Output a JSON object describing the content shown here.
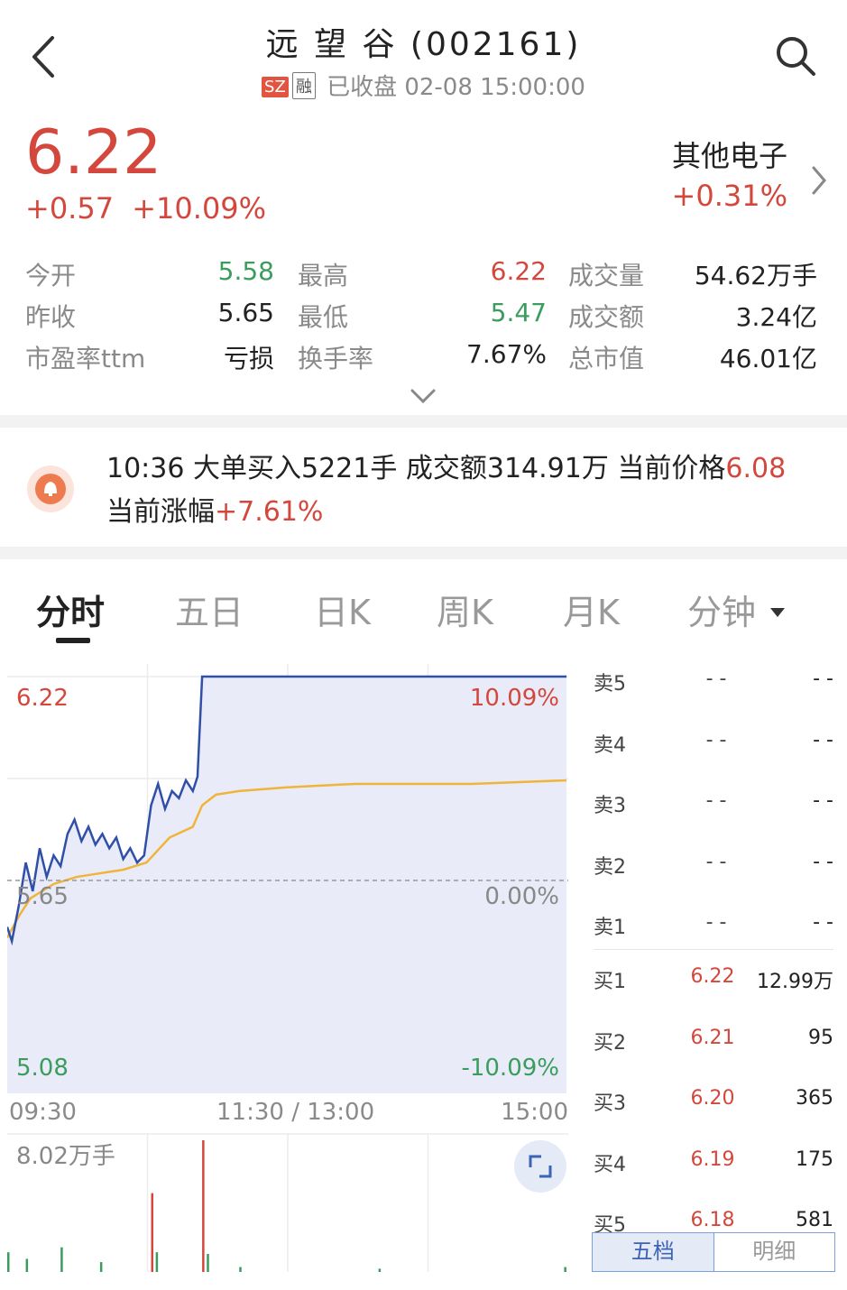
{
  "header": {
    "title": "远 望 谷 (002161)",
    "badge_sz": "SZ",
    "badge_rong": "融",
    "status": "已收盘 02-08 15:00:00"
  },
  "quote": {
    "price": "6.22",
    "change": "+0.57",
    "change_pct": "+10.09%",
    "sector_name": "其他电子",
    "sector_change": "+0.31%"
  },
  "stats": [
    [
      {
        "label": "今开",
        "value": "5.58",
        "color": "green"
      },
      {
        "label": "最高",
        "value": "6.22",
        "color": "red"
      },
      {
        "label": "成交量",
        "value": "54.62万手",
        "color": "black"
      }
    ],
    [
      {
        "label": "昨收",
        "value": "5.65",
        "color": "black"
      },
      {
        "label": "最低",
        "value": "5.47",
        "color": "green"
      },
      {
        "label": "成交额",
        "value": "3.24亿",
        "color": "black"
      }
    ],
    [
      {
        "label": "市盈率ttm",
        "value": "亏损",
        "color": "black"
      },
      {
        "label": "换手率",
        "value": "7.67%",
        "color": "black"
      },
      {
        "label": "总市值",
        "value": "46.01亿",
        "color": "black"
      }
    ]
  ],
  "notice": {
    "prefix": "10:36 大单买入5221手 成交额314.91万 当前价格",
    "price": "6.08",
    "line2_prefix": "当前涨幅",
    "pct": "+7.61%"
  },
  "tabs": [
    "分时",
    "五日",
    "日K",
    "周K",
    "月K",
    "分钟"
  ],
  "chart": {
    "price_high": "6.22",
    "pct_high": "10.09%",
    "price_mid": "5.65",
    "pct_mid": "0.00%",
    "price_low": "5.08",
    "pct_low": "-10.09%",
    "volume_max": "8.02万手",
    "time_labels": [
      "09:30",
      "11:30 / 13:00",
      "15:00"
    ]
  },
  "chart_data": {
    "type": "line",
    "ylim": [
      5.08,
      6.22
    ],
    "prev_close": 5.65,
    "series": [],
    "price": [
      [
        0,
        5.52
      ],
      [
        2,
        5.48
      ],
      [
        5,
        5.58
      ],
      [
        8,
        5.7
      ],
      [
        11,
        5.62
      ],
      [
        14,
        5.74
      ],
      [
        17,
        5.66
      ],
      [
        20,
        5.72
      ],
      [
        23,
        5.69
      ],
      [
        26,
        5.78
      ],
      [
        29,
        5.82
      ],
      [
        32,
        5.76
      ],
      [
        35,
        5.8
      ],
      [
        38,
        5.75
      ],
      [
        41,
        5.78
      ],
      [
        44,
        5.74
      ],
      [
        47,
        5.77
      ],
      [
        50,
        5.71
      ],
      [
        53,
        5.74
      ],
      [
        56,
        5.7
      ],
      [
        59,
        5.72
      ],
      [
        62,
        5.86
      ],
      [
        65,
        5.92
      ],
      [
        68,
        5.85
      ],
      [
        71,
        5.9
      ],
      [
        74,
        5.88
      ],
      [
        77,
        5.93
      ],
      [
        80,
        5.9
      ],
      [
        82,
        5.94
      ],
      [
        84,
        6.22
      ],
      [
        120,
        6.22
      ],
      [
        241,
        6.22
      ]
    ],
    "avg": [
      [
        0,
        5.49
      ],
      [
        5,
        5.55
      ],
      [
        10,
        5.6
      ],
      [
        20,
        5.64
      ],
      [
        30,
        5.66
      ],
      [
        40,
        5.67
      ],
      [
        50,
        5.68
      ],
      [
        60,
        5.7
      ],
      [
        70,
        5.77
      ],
      [
        80,
        5.8
      ],
      [
        84,
        5.86
      ],
      [
        90,
        5.89
      ],
      [
        100,
        5.9
      ],
      [
        120,
        5.91
      ],
      [
        150,
        5.92
      ],
      [
        200,
        5.92
      ],
      [
        241,
        5.93
      ]
    ],
    "volume": [
      {
        "t": 0,
        "v": 1.2
      },
      {
        "t": 8,
        "v": 0.8
      },
      {
        "t": 23,
        "v": 1.5
      },
      {
        "t": 40,
        "v": 0.6
      },
      {
        "t": 62,
        "v": 4.8
      },
      {
        "t": 64,
        "v": 1.2
      },
      {
        "t": 84,
        "v": 8.02
      },
      {
        "t": 86,
        "v": 1.1
      },
      {
        "t": 100,
        "v": 0.3
      },
      {
        "t": 160,
        "v": 0.2
      },
      {
        "t": 240,
        "v": 0.3
      }
    ]
  },
  "orderbook": {
    "asks": [
      {
        "label": "卖5",
        "price": "- -",
        "vol": "- -"
      },
      {
        "label": "卖4",
        "price": "- -",
        "vol": "- -"
      },
      {
        "label": "卖3",
        "price": "- -",
        "vol": "- -"
      },
      {
        "label": "卖2",
        "price": "- -",
        "vol": "- -"
      },
      {
        "label": "卖1",
        "price": "- -",
        "vol": "- -"
      }
    ],
    "bids": [
      {
        "label": "买1",
        "price": "6.22",
        "vol": "12.99万"
      },
      {
        "label": "买2",
        "price": "6.21",
        "vol": "95"
      },
      {
        "label": "买3",
        "price": "6.20",
        "vol": "365"
      },
      {
        "label": "买4",
        "price": "6.19",
        "vol": "175"
      },
      {
        "label": "买5",
        "price": "6.18",
        "vol": "581"
      }
    ],
    "tab_five": "五档",
    "tab_detail": "明细"
  },
  "colors": {
    "up": "#d4473c",
    "down": "#3a9d5d",
    "price_line": "#2f4fa8",
    "avg_line": "#f0b43a",
    "fill": "#e9ecf8"
  }
}
